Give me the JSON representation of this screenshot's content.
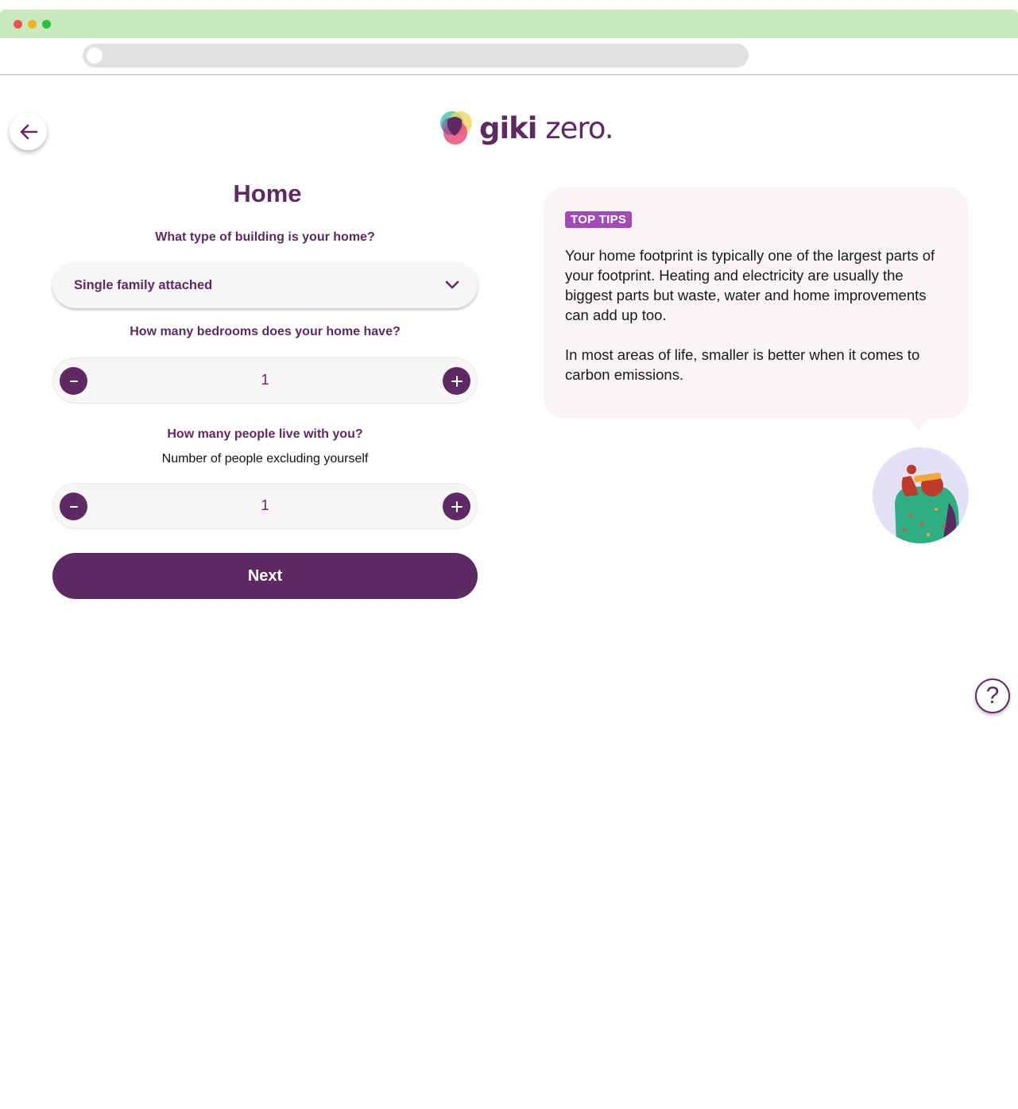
{
  "header": {
    "logo_bold": "giki",
    "logo_light": "zero."
  },
  "form": {
    "title": "Home",
    "building": {
      "label": "What type of building is your home?",
      "selected": "Single family attached"
    },
    "bedrooms": {
      "label": "How many bedrooms does your home have?",
      "value": "1"
    },
    "people": {
      "label": "How many people live with you?",
      "sublabel": "Number of people excluding yourself",
      "value": "1"
    },
    "next_label": "Next"
  },
  "tips": {
    "badge": "TOP TIPS",
    "paragraph1": "Your home footprint is typically one of the largest parts of your footprint. Heating and electricity are usually the biggest parts but waste, water and home improvements can add up too.",
    "paragraph2": "In most areas of life, smaller is better when it comes to carbon emissions."
  },
  "help": {
    "label": "?"
  },
  "colors": {
    "brand_purple": "#5e2a63",
    "badge_purple": "#a24bb4",
    "chrome_green": "#cbe9c0"
  },
  "icons": {
    "back": "arrow-left-icon",
    "select": "chevron-down-icon",
    "decrement": "minus-icon",
    "increment": "plus-icon",
    "help": "question-mark-icon"
  }
}
